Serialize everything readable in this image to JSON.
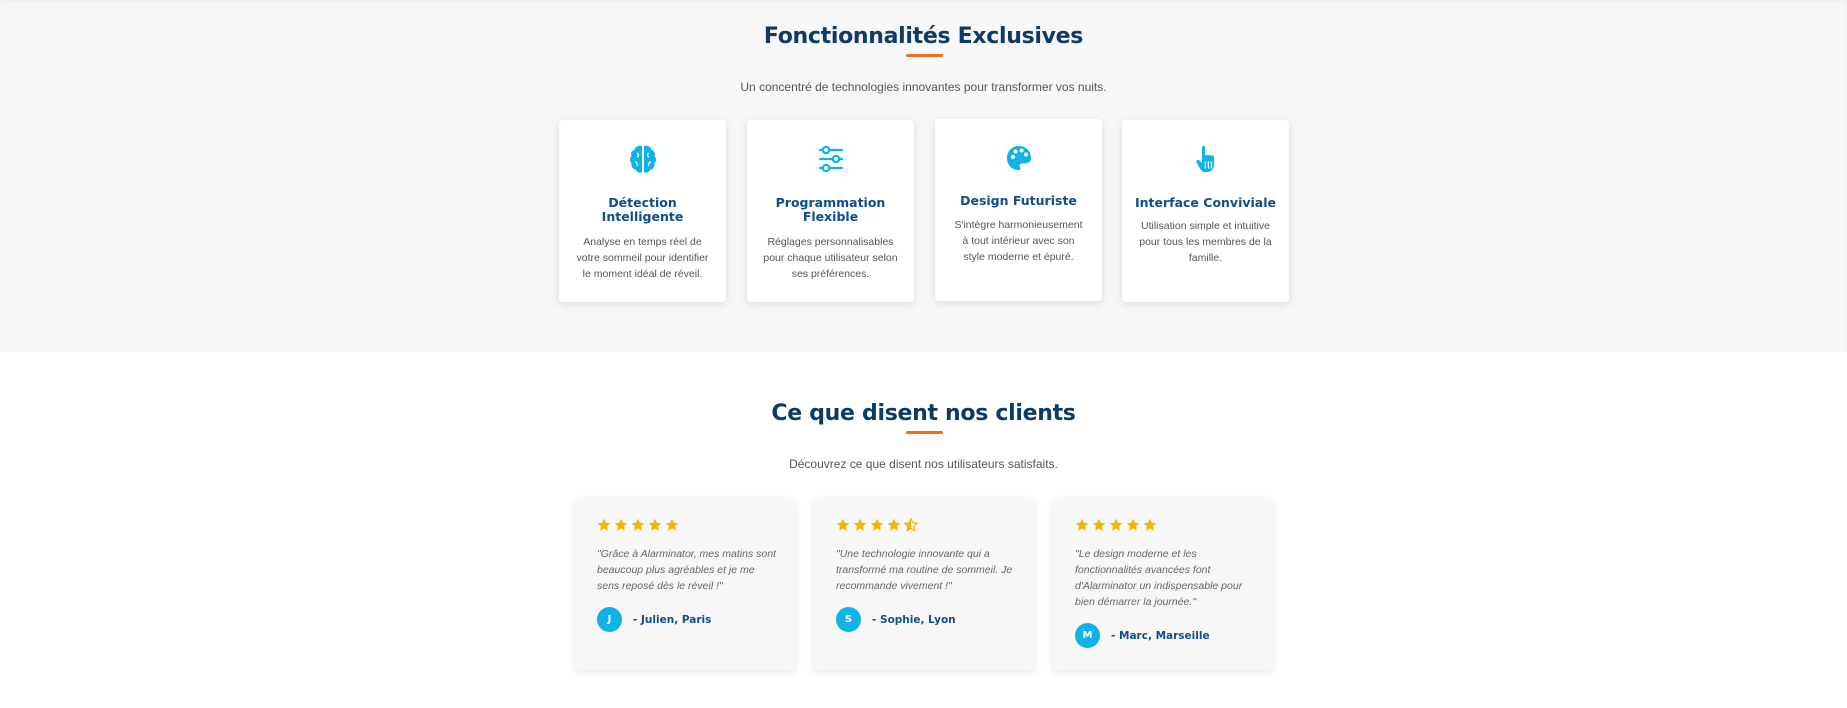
{
  "features_section": {
    "title": "Fonctionnalités Exclusives",
    "subtitle": "Un concentré de technologies innovantes pour transformer vos nuits.",
    "cards": [
      {
        "icon": "brain-icon",
        "title": "Détection Intelligente",
        "description": "Analyse en temps réel de votre sommeil pour identifier le moment idéal de réveil."
      },
      {
        "icon": "sliders-icon",
        "title": "Programmation Flexible",
        "description": "Réglages personnalisables pour chaque utilisateur selon ses préférences."
      },
      {
        "icon": "palette-icon",
        "title": "Design Futuriste",
        "description": "S'intègre harmonieusement à tout intérieur avec son style moderne et épuré."
      },
      {
        "icon": "hand-pointer-icon",
        "title": "Interface Conviviale",
        "description": "Utilisation simple et intuitive pour tous les membres de la famille."
      }
    ]
  },
  "testimonials_section": {
    "title": "Ce que disent nos clients",
    "subtitle": "Découvrez ce que disent nos utilisateurs satisfaits.",
    "testimonials": [
      {
        "rating": 5,
        "quote": "\"Grâce à Alarminator, mes matins sont beaucoup plus agréables et je me sens reposé dès le réveil !\"",
        "initial": "J",
        "author": "- Julien, Paris"
      },
      {
        "rating": 4.5,
        "quote": "\"Une technologie innovante qui a transformé ma routine de sommeil. Je recommande vivement !\"",
        "initial": "S",
        "author": "- Sophie, Lyon"
      },
      {
        "rating": 5,
        "quote": "\"Le design moderne et les fonctionnalités avancées font d'Alarminator un indispensable pour bien démarrer la journée.\"",
        "initial": "M",
        "author": "- Marc, Marseille"
      }
    ]
  },
  "colors": {
    "title": "#0d3b66",
    "accent": "#f26c1a",
    "icon": "#0fb3e8",
    "star": "#f5b400",
    "section_bg": "#f7f7f7"
  }
}
